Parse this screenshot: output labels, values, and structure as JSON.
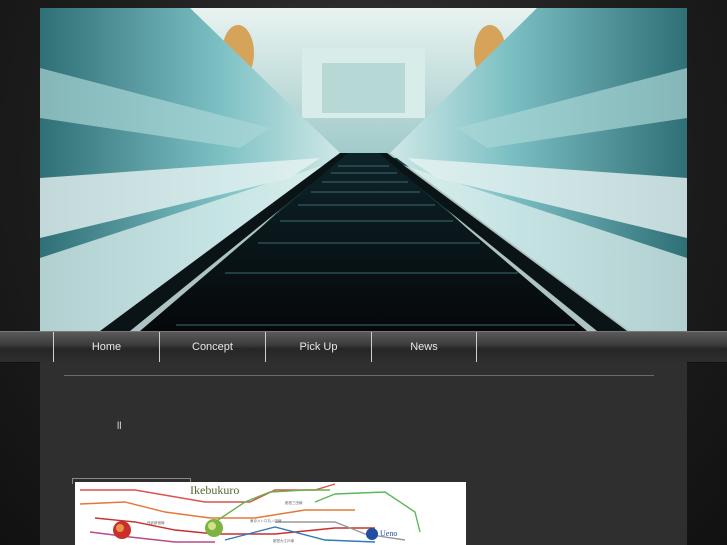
{
  "nav": {
    "items": [
      {
        "label": "Home"
      },
      {
        "label": "Concept"
      },
      {
        "label": "Pick Up"
      },
      {
        "label": "News"
      }
    ]
  },
  "content": {
    "marker": "ll"
  },
  "map": {
    "label_main": "Ikebukuro",
    "label_side": "Ueno"
  },
  "colors": {
    "nav_text": "#e8e8e8",
    "panel_bg": "#2f2f2f",
    "hero_teal": "#5fb0b8"
  }
}
